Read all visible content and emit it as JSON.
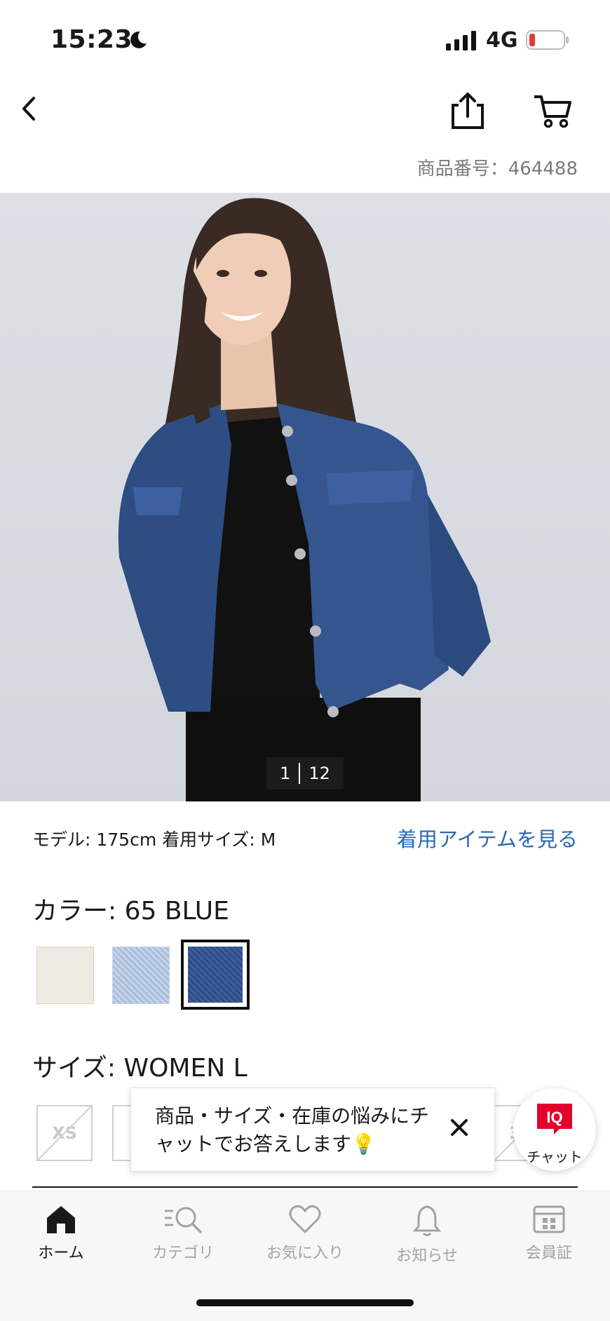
{
  "status_bar": {
    "time": "15:23",
    "network": "4G"
  },
  "header": {
    "product_number": "商品番号：464488"
  },
  "gallery": {
    "current": "1",
    "total": "12"
  },
  "model_info": {
    "text": "モデル: 175cm 着用サイズ: M",
    "see_items_link": "着用アイテムを見る"
  },
  "color": {
    "label": "カラー: 65 BLUE",
    "swatches": [
      {
        "name": "off-white",
        "color": "#eeebe2"
      },
      {
        "name": "light-blue",
        "color": "#b7c9e3"
      },
      {
        "name": "blue",
        "color": "#355795",
        "selected": true
      }
    ]
  },
  "size": {
    "label": "サイズ: WOMEN L",
    "first_option": "XS",
    "partial_option": "3X"
  },
  "chat_tooltip": {
    "message": "商品・サイズ・在庫の悩みにチャットでお答えします💡"
  },
  "chat_button": {
    "badge": "IQ",
    "label": "チャット"
  },
  "tabbar": {
    "items": [
      {
        "label": "ホーム",
        "icon": "home-icon",
        "active": true
      },
      {
        "label": "カテゴリ",
        "icon": "category-search-icon"
      },
      {
        "label": "お気に入り",
        "icon": "heart-icon"
      },
      {
        "label": "お知らせ",
        "icon": "bell-icon"
      },
      {
        "label": "会員証",
        "icon": "member-card-icon"
      }
    ]
  },
  "colors": {
    "link": "#2b67b3",
    "brand_red": "#e4002b"
  }
}
